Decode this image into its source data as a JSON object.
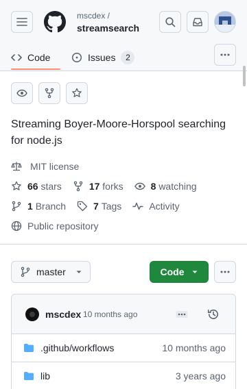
{
  "header": {
    "owner": "mscdex /",
    "repo": "streamsearch",
    "icons": [
      "hamburger-icon",
      "github-logo",
      "search-icon",
      "inbox-icon",
      "avatar"
    ]
  },
  "tabs": [
    {
      "label": "Code",
      "selected": true,
      "icon": "code-icon"
    },
    {
      "label": "Issues",
      "count": "2",
      "icon": "issue-icon"
    }
  ],
  "repo_actions": {
    "icons": [
      "eye-icon",
      "fork-icon",
      "star-icon"
    ]
  },
  "about": {
    "description": "Streaming Boyer-Moore-Horspool searching for node.js",
    "license": "MIT license",
    "stars_count": "66",
    "stars_label": "stars",
    "forks_count": "17",
    "forks_label": "forks",
    "watching_count": "8",
    "watching_label": "watching",
    "branch_count": "1",
    "branch_label": "Branch",
    "tags_count": "7",
    "tags_label": "Tags",
    "activity_label": "Activity",
    "visibility": "Public repository"
  },
  "toolbar": {
    "branch": "master",
    "code_label": "Code"
  },
  "latest_commit": {
    "author": "mscdex",
    "time": "10 months ago"
  },
  "files": [
    {
      "name": ".github/workflows",
      "date": "10 months ago",
      "type": "folder"
    },
    {
      "name": "lib",
      "date": "3 years ago",
      "type": "folder"
    }
  ],
  "colors": {
    "accent_green": "#1f883d",
    "folder_blue": "#54aeff",
    "tab_underline": "#fd8c73"
  }
}
